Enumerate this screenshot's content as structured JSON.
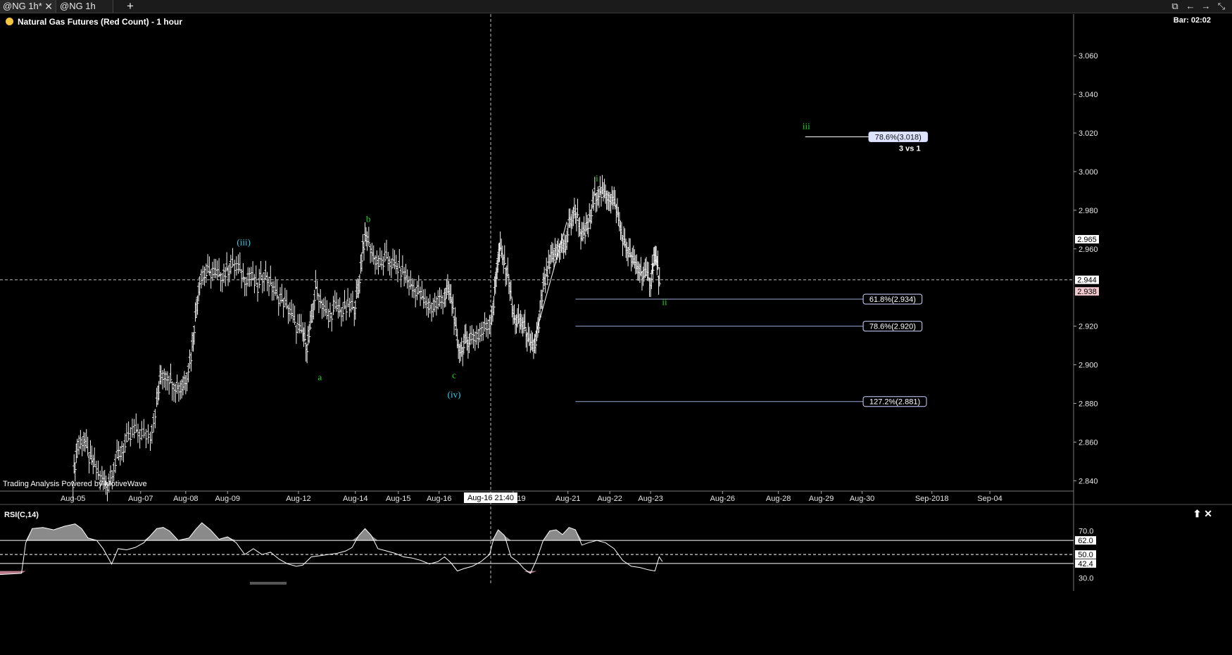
{
  "tabs": [
    {
      "label": "@NG 1h*",
      "close": "✕",
      "active": true
    },
    {
      "label": "@NG 1h",
      "active": false
    }
  ],
  "tab_add": "+",
  "window_icons": [
    "popout-icon",
    "arrow-left-icon",
    "arrow-right-icon",
    "collapse-icon"
  ],
  "chart_title": "Natural Gas Futures (Red Count) - 1 hour",
  "bar_info": "Bar: 02:02",
  "powered_by": "Trading Analysis Powered by MotiveWave",
  "crosshair": {
    "x_label": "Aug-16 21:40",
    "y_value": 2.944,
    "y_label": "2.944"
  },
  "colors": {
    "background": "#000000",
    "price_bars": "#ffffff",
    "wave_green": "#22d622",
    "wave_cyan": "#33ccee",
    "fib_line": "#9aa6d6"
  },
  "chart_data": [
    {
      "type": "bar",
      "ylim": [
        2.835,
        3.075
      ],
      "y_ticks": [
        "3.060",
        "3.040",
        "3.020",
        "3.000",
        "2.980",
        "2.960",
        "2.920",
        "2.900",
        "2.880",
        "2.860",
        "2.840"
      ],
      "x_ticks": [
        "Aug-05",
        "Aug-07",
        "Aug-08",
        "Aug-09",
        "Aug-12",
        "Aug-14",
        "Aug-15",
        "Aug-16",
        "Aug-19",
        "Aug-21",
        "Aug-22",
        "Aug-23",
        "Aug-26",
        "Aug-28",
        "Aug-29",
        "Aug-30",
        "Sep-2018",
        "Sep-04"
      ],
      "x_tick_positions": [
        0.068,
        0.131,
        0.173,
        0.212,
        0.278,
        0.331,
        0.371,
        0.409,
        0.478,
        0.529,
        0.568,
        0.606,
        0.673,
        0.725,
        0.765,
        0.803,
        0.868,
        0.922
      ],
      "price_path": [
        [
          0.068,
          2.84
        ],
        [
          0.072,
          2.858
        ],
        [
          0.078,
          2.862
        ],
        [
          0.083,
          2.852
        ],
        [
          0.088,
          2.848
        ],
        [
          0.095,
          2.84
        ],
        [
          0.1,
          2.838
        ],
        [
          0.106,
          2.848
        ],
        [
          0.112,
          2.855
        ],
        [
          0.118,
          2.86
        ],
        [
          0.125,
          2.866
        ],
        [
          0.132,
          2.864
        ],
        [
          0.14,
          2.864
        ],
        [
          0.146,
          2.88
        ],
        [
          0.15,
          2.895
        ],
        [
          0.156,
          2.895
        ],
        [
          0.162,
          2.89
        ],
        [
          0.168,
          2.888
        ],
        [
          0.173,
          2.893
        ],
        [
          0.178,
          2.905
        ],
        [
          0.182,
          2.925
        ],
        [
          0.186,
          2.945
        ],
        [
          0.192,
          2.948
        ],
        [
          0.198,
          2.948
        ],
        [
          0.204,
          2.946
        ],
        [
          0.21,
          2.948
        ],
        [
          0.215,
          2.952
        ],
        [
          0.222,
          2.95
        ],
        [
          0.228,
          2.945
        ],
        [
          0.234,
          2.946
        ],
        [
          0.24,
          2.94
        ],
        [
          0.246,
          2.948
        ],
        [
          0.252,
          2.942
        ],
        [
          0.258,
          2.936
        ],
        [
          0.264,
          2.933
        ],
        [
          0.27,
          2.928
        ],
        [
          0.276,
          2.92
        ],
        [
          0.282,
          2.916
        ],
        [
          0.286,
          2.91
        ],
        [
          0.29,
          2.922
        ],
        [
          0.294,
          2.94
        ],
        [
          0.3,
          2.932
        ],
        [
          0.306,
          2.924
        ],
        [
          0.312,
          2.93
        ],
        [
          0.318,
          2.928
        ],
        [
          0.324,
          2.93
        ],
        [
          0.33,
          2.93
        ],
        [
          0.334,
          2.94
        ],
        [
          0.338,
          2.962
        ],
        [
          0.342,
          2.966
        ],
        [
          0.348,
          2.956
        ],
        [
          0.354,
          2.952
        ],
        [
          0.36,
          2.955
        ],
        [
          0.366,
          2.952
        ],
        [
          0.372,
          2.95
        ],
        [
          0.378,
          2.946
        ],
        [
          0.384,
          2.94
        ],
        [
          0.39,
          2.938
        ],
        [
          0.396,
          2.932
        ],
        [
          0.402,
          2.93
        ],
        [
          0.408,
          2.932
        ],
        [
          0.414,
          2.936
        ],
        [
          0.418,
          2.938
        ],
        [
          0.422,
          2.93
        ],
        [
          0.426,
          2.91
        ],
        [
          0.43,
          2.908
        ],
        [
          0.434,
          2.912
        ],
        [
          0.438,
          2.914
        ],
        [
          0.444,
          2.915
        ],
        [
          0.45,
          2.918
        ],
        [
          0.456,
          2.922
        ],
        [
          0.46,
          2.932
        ],
        [
          0.463,
          2.952
        ],
        [
          0.466,
          2.96
        ],
        [
          0.47,
          2.952
        ],
        [
          0.474,
          2.945
        ],
        [
          0.478,
          2.925
        ],
        [
          0.482,
          2.922
        ],
        [
          0.486,
          2.922
        ],
        [
          0.49,
          2.918
        ],
        [
          0.494,
          2.908
        ],
        [
          0.498,
          2.91
        ],
        [
          0.502,
          2.92
        ],
        [
          0.506,
          2.94
        ],
        [
          0.51,
          2.948
        ],
        [
          0.514,
          2.955
        ],
        [
          0.518,
          2.958
        ],
        [
          0.522,
          2.962
        ],
        [
          0.526,
          2.96
        ],
        [
          0.53,
          2.972
        ],
        [
          0.534,
          2.978
        ],
        [
          0.538,
          2.978
        ],
        [
          0.542,
          2.965
        ],
        [
          0.546,
          2.97
        ],
        [
          0.55,
          2.976
        ],
        [
          0.554,
          2.988
        ],
        [
          0.558,
          2.99
        ],
        [
          0.562,
          2.988
        ],
        [
          0.566,
          2.988
        ],
        [
          0.57,
          2.986
        ],
        [
          0.574,
          2.982
        ],
        [
          0.578,
          2.97
        ],
        [
          0.582,
          2.962
        ],
        [
          0.586,
          2.958
        ],
        [
          0.59,
          2.953
        ],
        [
          0.594,
          2.95
        ],
        [
          0.598,
          2.948
        ],
        [
          0.602,
          2.946
        ],
        [
          0.606,
          2.944
        ],
        [
          0.609,
          2.955
        ],
        [
          0.612,
          2.954
        ],
        [
          0.615,
          2.938
        ]
      ],
      "trend_line": [
        [
          0.497,
          2.912
        ],
        [
          0.528,
          2.974
        ]
      ],
      "wave_labels": [
        {
          "text": "(iii)",
          "x": 0.227,
          "y": 2.962,
          "color": "cyan"
        },
        {
          "text": "b",
          "x": 0.343,
          "y": 2.974,
          "color": "green"
        },
        {
          "text": "a",
          "x": 0.298,
          "y": 2.892,
          "color": "green"
        },
        {
          "text": "c",
          "x": 0.423,
          "y": 2.893,
          "color": "green"
        },
        {
          "text": "(iv)",
          "x": 0.423,
          "y": 2.883,
          "color": "cyan"
        },
        {
          "text": "i",
          "x": 0.556,
          "y": 2.995,
          "color": "green"
        },
        {
          "text": "ii",
          "x": 0.619,
          "y": 2.931,
          "color": "green"
        },
        {
          "text": "iii",
          "x": 0.751,
          "y": 3.022,
          "color": "green"
        }
      ],
      "fib_levels": [
        {
          "label": "78.6%(3.018)",
          "value": 3.018,
          "x_start": 0.75,
          "x_end": 0.864,
          "note": "3 vs 1"
        },
        {
          "label": "61.8%(2.934)",
          "value": 2.934,
          "x_start": 0.536,
          "x_end": 0.804
        },
        {
          "label": "78.6%(2.920)",
          "value": 2.92,
          "x_start": 0.536,
          "x_end": 0.804
        },
        {
          "label": "127.2%(2.881)",
          "value": 2.881,
          "x_start": 0.536,
          "x_end": 0.804
        }
      ],
      "price_markers": [
        {
          "label": "2.965",
          "value": 2.965,
          "style": "white"
        },
        {
          "label": "2.944",
          "value": 2.944,
          "style": "white"
        },
        {
          "label": "2.938",
          "value": 2.938,
          "style": "pink"
        }
      ]
    },
    {
      "type": "line",
      "title": "RSI(C,14)",
      "ylim": [
        25,
        80
      ],
      "y_ticks": [
        "70.0",
        "30.0"
      ],
      "levels": [
        {
          "label": "62.0",
          "value": 62.0,
          "style": "solid"
        },
        {
          "label": "50.0",
          "value": 50.0,
          "style": "dashed"
        },
        {
          "label": "42.4",
          "value": 42.4,
          "style": "solid"
        }
      ],
      "values": [
        [
          0.0,
          33
        ],
        [
          0.02,
          34
        ],
        [
          0.024,
          60
        ],
        [
          0.03,
          72
        ],
        [
          0.04,
          73
        ],
        [
          0.05,
          71
        ],
        [
          0.06,
          74
        ],
        [
          0.07,
          76
        ],
        [
          0.076,
          72
        ],
        [
          0.082,
          64
        ],
        [
          0.09,
          62
        ],
        [
          0.096,
          55
        ],
        [
          0.104,
          42
        ],
        [
          0.11,
          55
        ],
        [
          0.118,
          54
        ],
        [
          0.126,
          56
        ],
        [
          0.134,
          60
        ],
        [
          0.14,
          66
        ],
        [
          0.146,
          72
        ],
        [
          0.152,
          73
        ],
        [
          0.158,
          70
        ],
        [
          0.166,
          62
        ],
        [
          0.176,
          64
        ],
        [
          0.182,
          71
        ],
        [
          0.188,
          77
        ],
        [
          0.196,
          71
        ],
        [
          0.204,
          63
        ],
        [
          0.212,
          65
        ],
        [
          0.22,
          60
        ],
        [
          0.228,
          50
        ],
        [
          0.236,
          55
        ],
        [
          0.244,
          50
        ],
        [
          0.252,
          52
        ],
        [
          0.26,
          46
        ],
        [
          0.268,
          42
        ],
        [
          0.276,
          40
        ],
        [
          0.282,
          41
        ],
        [
          0.29,
          48
        ],
        [
          0.298,
          49
        ],
        [
          0.306,
          50
        ],
        [
          0.314,
          51
        ],
        [
          0.322,
          53
        ],
        [
          0.328,
          56
        ],
        [
          0.334,
          66
        ],
        [
          0.34,
          72
        ],
        [
          0.346,
          66
        ],
        [
          0.352,
          55
        ],
        [
          0.36,
          53
        ],
        [
          0.368,
          51
        ],
        [
          0.376,
          48
        ],
        [
          0.384,
          47
        ],
        [
          0.392,
          45
        ],
        [
          0.4,
          42
        ],
        [
          0.408,
          44
        ],
        [
          0.414,
          48
        ],
        [
          0.42,
          43
        ],
        [
          0.426,
          36
        ],
        [
          0.432,
          38
        ],
        [
          0.44,
          40
        ],
        [
          0.448,
          44
        ],
        [
          0.456,
          50
        ],
        [
          0.46,
          64
        ],
        [
          0.464,
          71
        ],
        [
          0.47,
          66
        ],
        [
          0.476,
          48
        ],
        [
          0.482,
          44
        ],
        [
          0.488,
          38
        ],
        [
          0.494,
          34
        ],
        [
          0.5,
          46
        ],
        [
          0.506,
          62
        ],
        [
          0.512,
          70
        ],
        [
          0.518,
          71
        ],
        [
          0.524,
          67
        ],
        [
          0.53,
          73
        ],
        [
          0.536,
          71
        ],
        [
          0.542,
          58
        ],
        [
          0.548,
          60
        ],
        [
          0.556,
          62
        ],
        [
          0.564,
          60
        ],
        [
          0.572,
          55
        ],
        [
          0.58,
          45
        ],
        [
          0.588,
          40
        ],
        [
          0.596,
          39
        ],
        [
          0.604,
          37
        ],
        [
          0.61,
          36
        ],
        [
          0.614,
          48
        ],
        [
          0.617,
          44
        ]
      ]
    }
  ],
  "rsi_icons": [
    "maximize-up-icon",
    "close-icon"
  ],
  "rsi_icon_glyphs": [
    "⬆",
    "✕"
  ]
}
